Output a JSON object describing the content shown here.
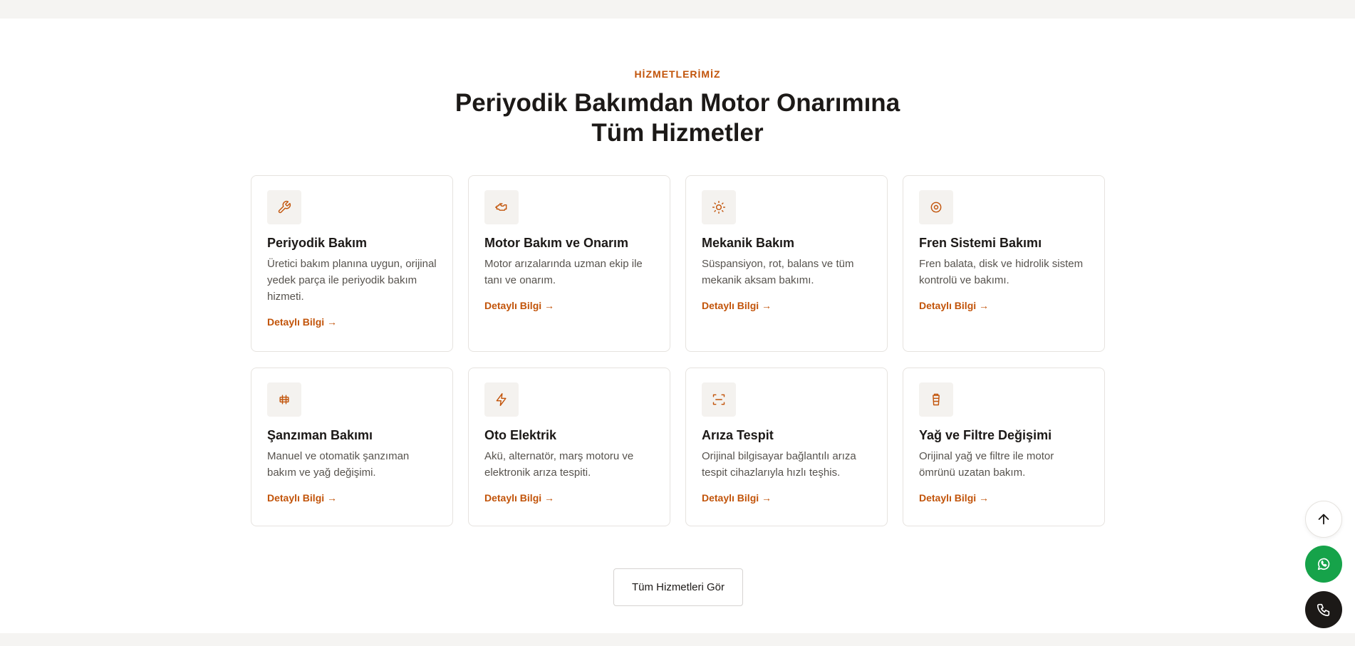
{
  "section": {
    "eyebrow": "HİZMETLERİMİZ",
    "title": "Periyodik Bakımdan Motor Onarımına Tüm Hizmetler"
  },
  "services": [
    {
      "icon": "wrench-icon",
      "title": "Periyodik Bakım",
      "desc": "Üretici bakım planına uygun, orijinal yedek parça ile periyodik bakım hizmeti.",
      "link": "Detaylı Bilgi →"
    },
    {
      "icon": "engine-icon",
      "title": "Motor Bakım ve Onarım",
      "desc": "Motor arızalarında uzman ekip ile tanı ve onarım.",
      "link": "Detaylı Bilgi →"
    },
    {
      "icon": "cog-icon",
      "title": "Mekanik Bakım",
      "desc": "Süspansiyon, rot, balans ve tüm mekanik aksam bakımı.",
      "link": "Detaylı Bilgi →"
    },
    {
      "icon": "disc-icon",
      "title": "Fren Sistemi Bakımı",
      "desc": "Fren balata, disk ve hidrolik sistem kontrolü ve bakımı.",
      "link": "Detaylı Bilgi →"
    },
    {
      "icon": "gearbox-icon",
      "title": "Şanzıman Bakımı",
      "desc": "Manuel ve otomatik şanzıman bakım ve yağ değişimi.",
      "link": "Detaylı Bilgi →"
    },
    {
      "icon": "lightning-icon",
      "title": "Oto Elektrik",
      "desc": "Akü, alternatör, marş motoru ve elektronik arıza tespiti.",
      "link": "Detaylı Bilgi →"
    },
    {
      "icon": "scan-icon",
      "title": "Arıza Tespit",
      "desc": "Orijinal bilgisayar bağlantılı arıza tespit cihazlarıyla hızlı teşhis.",
      "link": "Detaylı Bilgi →"
    },
    {
      "icon": "oil-filter-icon",
      "title": "Yağ ve Filtre Değişimi",
      "desc": "Orijinal yağ ve filtre ile motor ömrünü uzatan bakım.",
      "link": "Detaylı Bilgi →"
    }
  ],
  "cta": {
    "all_services": "Tüm Hizmetleri Gör"
  },
  "floating": {
    "scroll_top_icon": "arrow-up-icon",
    "whatsapp_icon": "whatsapp-icon",
    "phone_icon": "phone-icon"
  },
  "colors": {
    "accent": "#c2540a",
    "whatsapp": "#16a34a",
    "phone": "#1c1917"
  }
}
